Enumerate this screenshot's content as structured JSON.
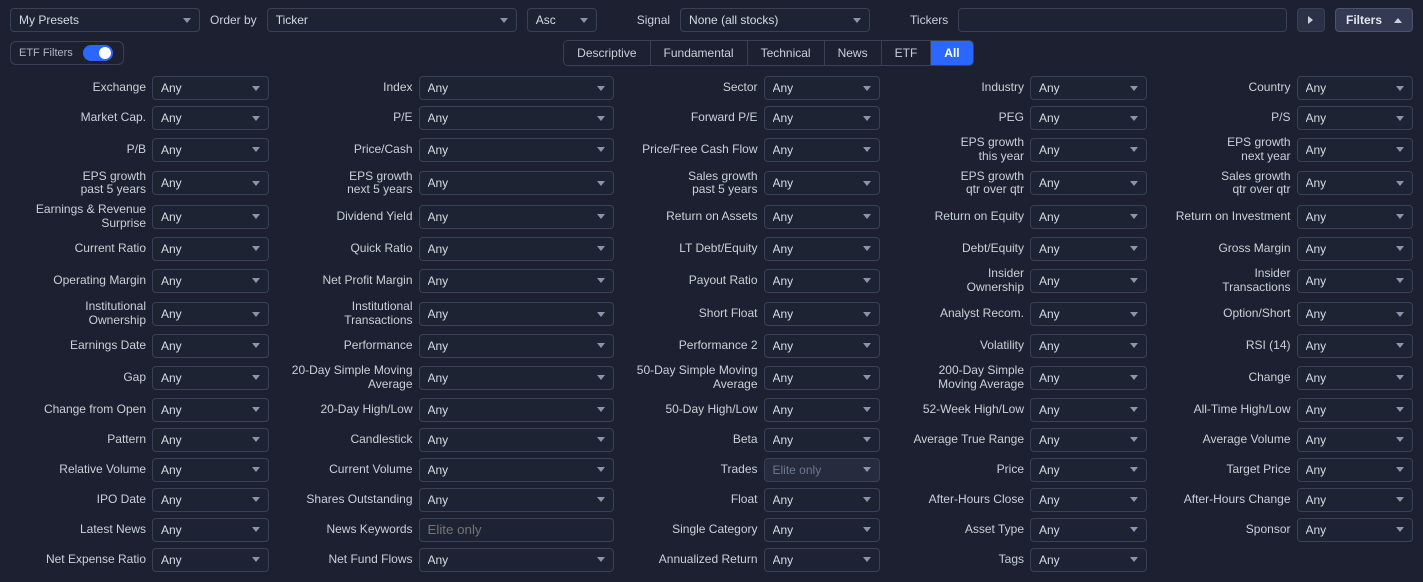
{
  "topbar": {
    "presets_label": "My Presets",
    "orderby_label": "Order by",
    "orderby_value": "Ticker",
    "orderdir_value": "Asc",
    "signal_label": "Signal",
    "signal_value": "None (all stocks)",
    "tickers_label": "Tickers",
    "tickers_value": "",
    "filters_button": "Filters"
  },
  "row2": {
    "etf_filters_label": "ETF Filters",
    "tabs": [
      "Descriptive",
      "Fundamental",
      "Technical",
      "News",
      "ETF",
      "All"
    ],
    "active_tab": "All"
  },
  "any": "Any",
  "elite": "Elite only",
  "filters": [
    [
      {
        "label": "Exchange",
        "value": "Any"
      },
      {
        "label": "Index",
        "value": "Any"
      },
      {
        "label": "Sector",
        "value": "Any"
      },
      {
        "label": "Industry",
        "value": "Any"
      },
      {
        "label": "Country",
        "value": "Any"
      }
    ],
    [
      {
        "label": "Market Cap.",
        "value": "Any"
      },
      {
        "label": "P/E",
        "value": "Any"
      },
      {
        "label": "Forward P/E",
        "value": "Any"
      },
      {
        "label": "PEG",
        "value": "Any"
      },
      {
        "label": "P/S",
        "value": "Any"
      }
    ],
    [
      {
        "label": "P/B",
        "value": "Any"
      },
      {
        "label": "Price/Cash",
        "value": "Any"
      },
      {
        "label": "Price/Free Cash Flow",
        "value": "Any"
      },
      {
        "label": "EPS growth\nthis year",
        "value": "Any"
      },
      {
        "label": "EPS growth\nnext year",
        "value": "Any"
      }
    ],
    [
      {
        "label": "EPS growth\npast 5 years",
        "value": "Any"
      },
      {
        "label": "EPS growth\nnext 5 years",
        "value": "Any"
      },
      {
        "label": "Sales growth\npast 5 years",
        "value": "Any"
      },
      {
        "label": "EPS growth\nqtr over qtr",
        "value": "Any"
      },
      {
        "label": "Sales growth\nqtr over qtr",
        "value": "Any"
      }
    ],
    [
      {
        "label": "Earnings & Revenue\nSurprise",
        "value": "Any"
      },
      {
        "label": "Dividend Yield",
        "value": "Any"
      },
      {
        "label": "Return on Assets",
        "value": "Any"
      },
      {
        "label": "Return on Equity",
        "value": "Any"
      },
      {
        "label": "Return on Investment",
        "value": "Any"
      }
    ],
    [
      {
        "label": "Current Ratio",
        "value": "Any"
      },
      {
        "label": "Quick Ratio",
        "value": "Any"
      },
      {
        "label": "LT Debt/Equity",
        "value": "Any"
      },
      {
        "label": "Debt/Equity",
        "value": "Any"
      },
      {
        "label": "Gross Margin",
        "value": "Any"
      }
    ],
    [
      {
        "label": "Operating Margin",
        "value": "Any"
      },
      {
        "label": "Net Profit Margin",
        "value": "Any"
      },
      {
        "label": "Payout Ratio",
        "value": "Any"
      },
      {
        "label": "Insider\nOwnership",
        "value": "Any"
      },
      {
        "label": "Insider\nTransactions",
        "value": "Any"
      }
    ],
    [
      {
        "label": "Institutional\nOwnership",
        "value": "Any"
      },
      {
        "label": "Institutional\nTransactions",
        "value": "Any"
      },
      {
        "label": "Short Float",
        "value": "Any"
      },
      {
        "label": "Analyst Recom.",
        "value": "Any"
      },
      {
        "label": "Option/Short",
        "value": "Any"
      }
    ],
    [
      {
        "label": "Earnings Date",
        "value": "Any"
      },
      {
        "label": "Performance",
        "value": "Any"
      },
      {
        "label": "Performance 2",
        "value": "Any"
      },
      {
        "label": "Volatility",
        "value": "Any"
      },
      {
        "label": "RSI (14)",
        "value": "Any"
      }
    ],
    [
      {
        "label": "Gap",
        "value": "Any"
      },
      {
        "label": "20-Day Simple Moving\nAverage",
        "value": "Any"
      },
      {
        "label": "50-Day Simple Moving\nAverage",
        "value": "Any"
      },
      {
        "label": "200-Day Simple\nMoving Average",
        "value": "Any"
      },
      {
        "label": "Change",
        "value": "Any"
      }
    ],
    [
      {
        "label": "Change from Open",
        "value": "Any"
      },
      {
        "label": "20-Day High/Low",
        "value": "Any"
      },
      {
        "label": "50-Day High/Low",
        "value": "Any"
      },
      {
        "label": "52-Week High/Low",
        "value": "Any"
      },
      {
        "label": "All-Time High/Low",
        "value": "Any"
      }
    ],
    [
      {
        "label": "Pattern",
        "value": "Any"
      },
      {
        "label": "Candlestick",
        "value": "Any"
      },
      {
        "label": "Beta",
        "value": "Any"
      },
      {
        "label": "Average True Range",
        "value": "Any"
      },
      {
        "label": "Average Volume",
        "value": "Any"
      }
    ],
    [
      {
        "label": "Relative Volume",
        "value": "Any"
      },
      {
        "label": "Current Volume",
        "value": "Any"
      },
      {
        "label": "Trades",
        "value": "Elite only",
        "elite": true
      },
      {
        "label": "Price",
        "value": "Any"
      },
      {
        "label": "Target Price",
        "value": "Any"
      }
    ],
    [
      {
        "label": "IPO Date",
        "value": "Any"
      },
      {
        "label": "Shares Outstanding",
        "value": "Any"
      },
      {
        "label": "Float",
        "value": "Any"
      },
      {
        "label": "After-Hours Close",
        "value": "Any"
      },
      {
        "label": "After-Hours Change",
        "value": "Any"
      }
    ],
    [
      {
        "label": "Latest News",
        "value": "Any"
      },
      {
        "label": "News Keywords",
        "value": "Elite only",
        "input": true
      },
      {
        "label": "Single Category",
        "value": "Any"
      },
      {
        "label": "Asset Type",
        "value": "Any"
      },
      {
        "label": "Sponsor",
        "value": "Any"
      }
    ],
    [
      {
        "label": "Net Expense Ratio",
        "value": "Any"
      },
      {
        "label": "Net Fund Flows",
        "value": "Any"
      },
      {
        "label": "Annualized Return",
        "value": "Any"
      },
      {
        "label": "Tags",
        "value": "Any"
      },
      {
        "label": "",
        "value": "",
        "empty": true
      }
    ]
  ]
}
